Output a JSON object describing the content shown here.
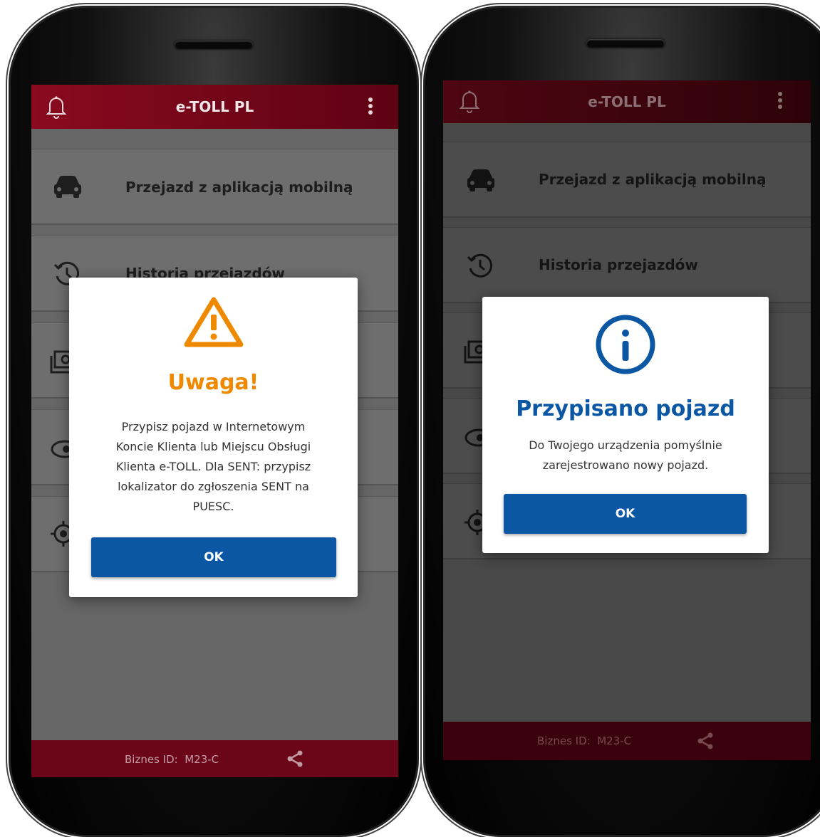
{
  "app": {
    "title": "e-TOLL PL",
    "brand_color": "#6b0619",
    "overlay_color": "#666666",
    "accent_blue": "#0b57a4",
    "warning_orange": "#ef8a00"
  },
  "menu": {
    "items": [
      {
        "label": "Przejazd z aplikacją mobilną",
        "icon": "car-icon"
      },
      {
        "label": "Historia przejazdów",
        "icon": "history-icon"
      },
      {
        "label": "",
        "icon": "wallet-icon"
      },
      {
        "label": "",
        "icon": "eye-icon"
      },
      {
        "label": "",
        "icon": "location-target-icon"
      }
    ]
  },
  "footer": {
    "business_id_label": "Biznes ID:",
    "business_id_value": "M23-C"
  },
  "dialog_warning": {
    "icon": "warning-triangle-icon",
    "title": "Uwaga!",
    "message_lines": [
      "Przypisz pojazd w Internetowym",
      "Koncie Klienta lub Miejscu Obsługi",
      "Klienta e-TOLL. Dla SENT: przypisz",
      "lokalizator do zgłoszenia SENT na",
      "PUESC."
    ],
    "button_label": "OK"
  },
  "dialog_info": {
    "icon": "info-circle-icon",
    "title": "Przypisano pojazd",
    "message_lines": [
      "Do Twojego urządzenia pomyślnie",
      "zarejestrowano nowy pojazd."
    ],
    "button_label": "OK"
  }
}
